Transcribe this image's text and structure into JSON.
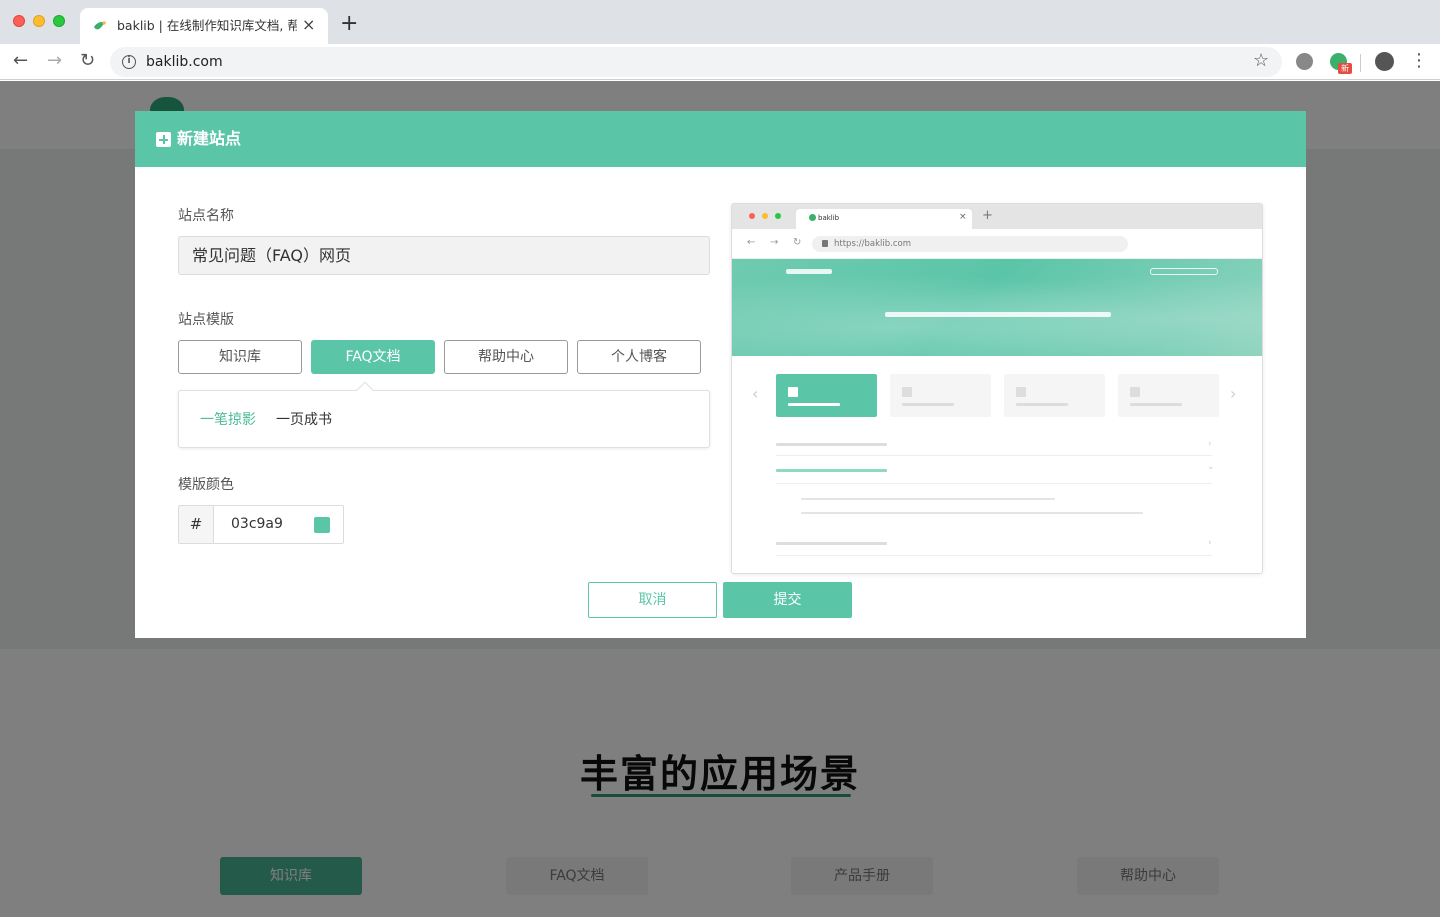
{
  "browser": {
    "tab_title": "baklib | 在线制作知识库文档, 帮助中心",
    "tab_close": "×",
    "new_tab": "+",
    "url": "baklib.com",
    "info_glyph": "i",
    "star_glyph": "☆",
    "ext_badge": "新",
    "menu_glyph": "⋮",
    "nav_back": "←",
    "nav_forward": "→",
    "nav_reload": "↻"
  },
  "page": {
    "section_title": "丰富的应用场景",
    "scene_tabs": [
      {
        "label": "知识库",
        "active": true
      },
      {
        "label": "FAQ文档",
        "active": false
      },
      {
        "label": "产品手册",
        "active": false
      },
      {
        "label": "帮助中心",
        "active": false
      }
    ]
  },
  "modal": {
    "title": "新建站点",
    "name_label": "站点名称",
    "name_value": "常见问题（FAQ）网页",
    "template_label": "站点模版",
    "templates": [
      {
        "label": "知识库",
        "active": false
      },
      {
        "label": "FAQ文档",
        "active": true
      },
      {
        "label": "帮助中心",
        "active": false
      },
      {
        "label": "个人博客",
        "active": false
      }
    ],
    "sub_templates": [
      {
        "label": "一笔掠影",
        "active": true
      },
      {
        "label": "一页成书",
        "active": false
      }
    ],
    "color_label": "模版颜色",
    "color_hash": "#",
    "color_value": "03c9a9",
    "cancel_label": "取消",
    "submit_label": "提交"
  },
  "preview": {
    "tab_title": "baklib",
    "tab_close": "×",
    "new_tab": "+",
    "url": "https://baklib.com",
    "arrow_left": "‹",
    "arrow_right": "›",
    "chevron_right": "›",
    "chevron_down": "⌄"
  },
  "colors": {
    "accent": "#5bc5a8",
    "header_bg": "#5bc5a8",
    "overlay": "rgba(0,0,0,0.5)"
  }
}
